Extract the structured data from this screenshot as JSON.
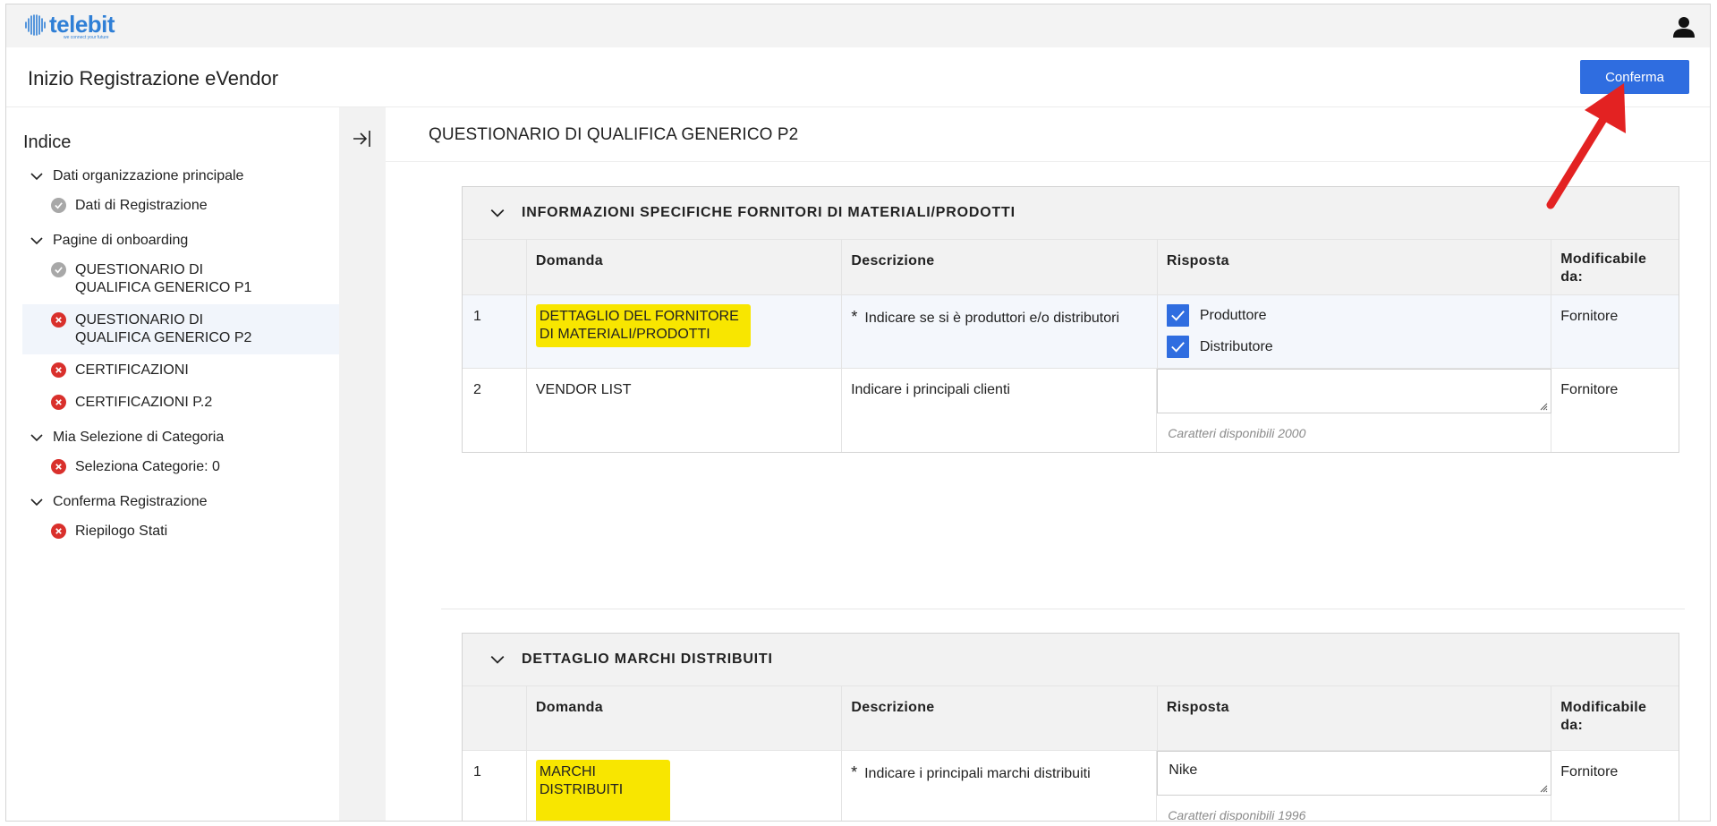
{
  "brand": {
    "name": "telebit",
    "tagline": "we connect your future",
    "color": "#2f7fd6"
  },
  "header": {
    "title": "Inizio Registrazione eVendor",
    "confirm_label": "Conferma"
  },
  "sidebar": {
    "title": "Indice",
    "groups": [
      {
        "label": "Dati organizzazione principale",
        "items": [
          {
            "label": "Dati di Registrazione",
            "status": "ok"
          }
        ]
      },
      {
        "label": "Pagine di onboarding",
        "items": [
          {
            "label": "QUESTIONARIO DI QUALIFICA GENERICO P1",
            "status": "ok"
          },
          {
            "label": "QUESTIONARIO DI QUALIFICA GENERICO P2",
            "status": "error",
            "active": true
          },
          {
            "label": "CERTIFICAZIONI",
            "status": "error"
          },
          {
            "label": "CERTIFICAZIONI P.2",
            "status": "error"
          }
        ]
      },
      {
        "label": "Mia Selezione di Categoria",
        "items": [
          {
            "label": "Seleziona Categorie: 0",
            "status": "error"
          }
        ]
      },
      {
        "label": "Conferma Registrazione",
        "items": [
          {
            "label": "Riepilogo Stati",
            "status": "error"
          }
        ]
      }
    ]
  },
  "content": {
    "title": "QUESTIONARIO DI QUALIFICA GENERICO P2",
    "columns": {
      "num": "",
      "domanda": "Domanda",
      "descrizione": "Descrizione",
      "risposta": "Risposta",
      "modificabile": "Modificabile da:"
    },
    "section1": {
      "title": "INFORMAZIONI SPECIFICHE FORNITORI DI MATERIALI/PRODOTTI",
      "rows": [
        {
          "num": "1",
          "domanda": "DETTAGLIO DEL FORNITORE DI MATERIALI/PRODOTTI",
          "required": "*",
          "descrizione": "Indicare se si è produttori e/o distributori",
          "options": [
            "Produttore",
            "Distributore"
          ],
          "modificabile": "Fornitore"
        },
        {
          "num": "2",
          "domanda": "VENDOR LIST",
          "descrizione": "Indicare i principali clienti",
          "value": "",
          "chars": "Caratteri disponibili 2000",
          "modificabile": "Fornitore"
        }
      ]
    },
    "section2": {
      "title": "DETTAGLIO MARCHI DISTRIBUITI",
      "rows": [
        {
          "num": "1",
          "domanda": "MARCHI DISTRIBUITI",
          "required": "*",
          "descrizione": "Indicare i principali marchi distribuiti",
          "value": "Nike",
          "chars": "Caratteri disponibili 1996",
          "modificabile": "Fornitore"
        }
      ]
    }
  },
  "colors": {
    "primary": "#2f6de0",
    "highlight": "#f8e600",
    "error": "#d9302c",
    "ok": "#a8a8a8",
    "annotation_arrow": "#e32222"
  }
}
